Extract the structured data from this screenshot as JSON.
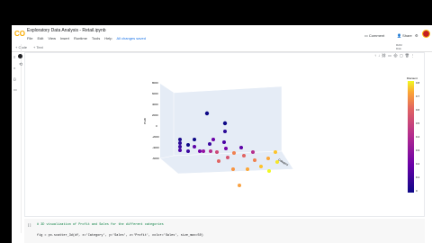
{
  "app": {
    "logo": "CO",
    "title": "Exploratory Data Analysis - Retail.ipynb"
  },
  "menu": [
    "File",
    "Edit",
    "View",
    "Insert",
    "Runtime",
    "Tools",
    "Help",
    "All changes saved"
  ],
  "topbar": {
    "comment_label": "Comment",
    "share_label": "Share",
    "ram_label": "RAM",
    "disk_label": "Disk"
  },
  "cells_toolbar": {
    "code_label": "+ Code",
    "text_label": "+ Text"
  },
  "code_lines": [
    "# 3D visualization of Profit and Sales for the different categories",
    "fig = px.scatter_3d(df, x='Category', y='Sales', z='Profit', color='Sales', size_max=50)"
  ],
  "colorbar": {
    "title": "Discount",
    "ticks": [
      "0.8",
      "0.7",
      "0.6",
      "0.5",
      "0.4",
      "0.3",
      "0.2",
      "0.1",
      "0"
    ]
  },
  "axes": {
    "z_label": "Profit",
    "x_label": "Category",
    "z_ticks": [
      "8000",
      "6000",
      "4000",
      "2000",
      "0",
      "-2000",
      "-4000",
      "-6000"
    ]
  },
  "colors": {
    "accent": "#f9ab00",
    "plot_bg": "#e5ecf6"
  }
}
